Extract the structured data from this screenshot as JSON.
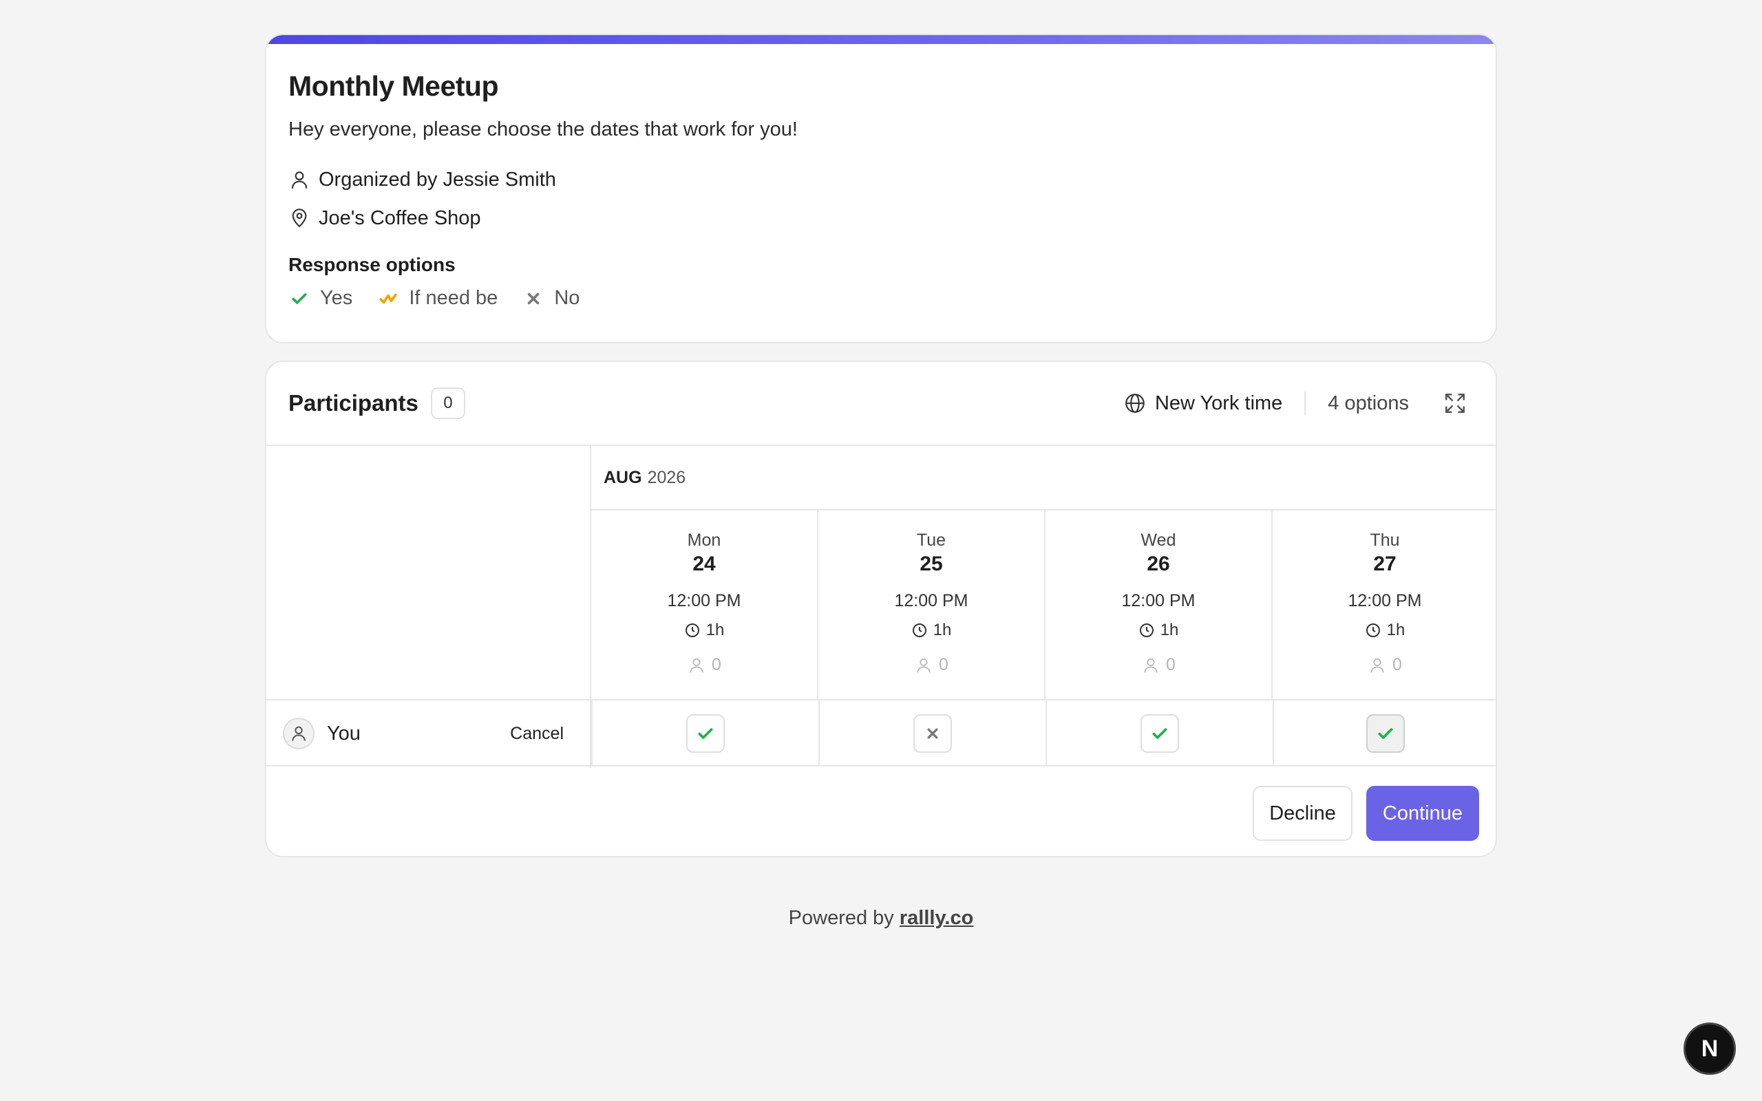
{
  "event": {
    "title": "Monthly Meetup",
    "description": "Hey everyone, please choose the dates that work for you!",
    "organizer": "Organized by Jessie Smith",
    "location": "Joe's Coffee Shop",
    "response_options_label": "Response options",
    "options": [
      {
        "label": "Yes",
        "icon": "check-icon",
        "color": "#22b04b"
      },
      {
        "label": "If need be",
        "icon": "check-wavy-icon",
        "color": "#f0a400"
      },
      {
        "label": "No",
        "icon": "x-icon",
        "color": "#777777"
      }
    ],
    "accent_gradient": [
      "#4f46e5",
      "#8b86f0"
    ]
  },
  "poll": {
    "title": "Participants",
    "participant_count": "0",
    "timezone_label": "New York time",
    "options_count_label": "4 options",
    "month": "AUG",
    "year": "2026",
    "dates": [
      {
        "dow": "Mon",
        "day": "24",
        "time": "12:00 PM",
        "duration": "1h",
        "count": "0",
        "vote": "yes"
      },
      {
        "dow": "Tue",
        "day": "25",
        "time": "12:00 PM",
        "duration": "1h",
        "count": "0",
        "vote": "no"
      },
      {
        "dow": "Wed",
        "day": "26",
        "time": "12:00 PM",
        "duration": "1h",
        "count": "0",
        "vote": "yes"
      },
      {
        "dow": "Thu",
        "day": "27",
        "time": "12:00 PM",
        "duration": "1h",
        "count": "0",
        "vote": "yes"
      }
    ],
    "you_label": "You",
    "cancel_label": "Cancel",
    "decline_label": "Decline",
    "continue_label": "Continue",
    "primary_color": "#6b63e6"
  },
  "footer": {
    "powered_prefix": "Powered by",
    "powered_link": "rallly.co"
  },
  "dev_badge": "N"
}
